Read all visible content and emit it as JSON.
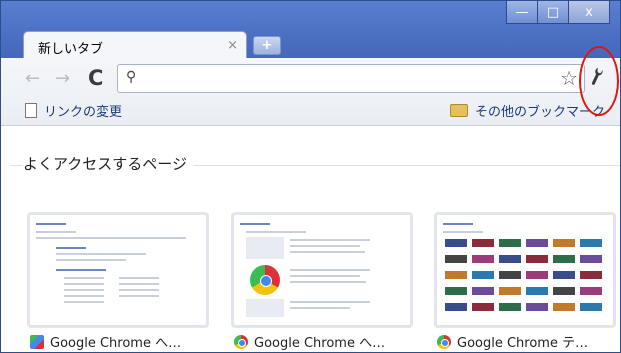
{
  "window": {
    "buttons": {
      "minimize": "—",
      "maximize": "□",
      "close": "x"
    }
  },
  "tab": {
    "title": "新しいタブ",
    "close": "×",
    "new_tab": "+"
  },
  "toolbar": {
    "back_icon": "←",
    "forward_icon": "→",
    "reload_icon": "C",
    "search_icon": "⚲",
    "star_icon": "☆",
    "wrench_icon": "🔧"
  },
  "bookmarks": {
    "left_label": "リンクの変更",
    "right_label": "その他のブックマーク"
  },
  "content": {
    "section_title": "よくアクセスするページ",
    "thumbnails": [
      {
        "title": "Google Chrome へ…",
        "favicon": "puzzle-icon"
      },
      {
        "title": "Google Chrome へ…",
        "favicon": "chrome-icon"
      },
      {
        "title": "Google Chrome テ…",
        "favicon": "chrome-icon"
      }
    ]
  },
  "colors": {
    "titlebar": "#4b6fc3",
    "highlight": "#e31414"
  }
}
